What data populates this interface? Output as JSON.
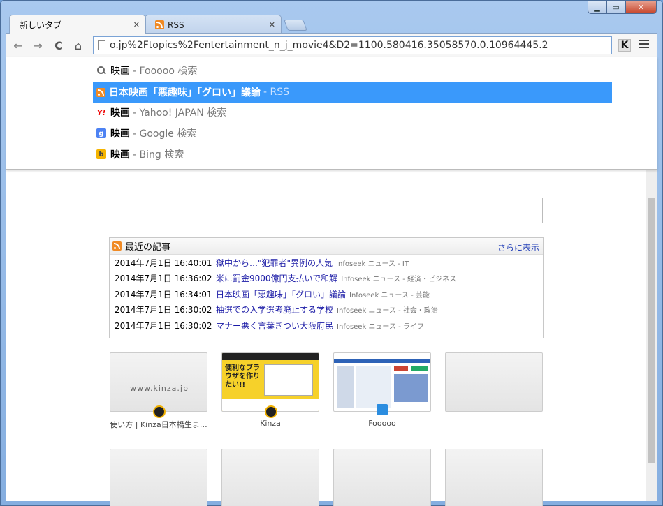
{
  "tabs": [
    {
      "label": "新しいタブ",
      "active": true
    },
    {
      "label": "RSS",
      "active": false
    }
  ],
  "window_controls": {
    "min": "▁",
    "max": "▭",
    "close": "✕"
  },
  "tab_close": "✕",
  "toolbar": {
    "back": "←",
    "forward": "→",
    "reload": "C",
    "home": "⌂",
    "url": "o.jp%2Ftopics%2Fentertainment_n_j_movie4&D2=1100.580416.35058570.0.10964445.2",
    "ext_label": "K"
  },
  "suggestions": [
    {
      "icon": "search-icon",
      "query": "映画",
      "suffix": "- Fooooo 検索",
      "selected": false
    },
    {
      "icon": "rss-icon",
      "query": "日本映画「悪趣味」「グロい」議論",
      "suffix": "- RSS",
      "selected": true
    },
    {
      "icon": "yahoo-icon",
      "query": "映画",
      "suffix": "- Yahoo! JAPAN 検索",
      "selected": false
    },
    {
      "icon": "google-icon",
      "query": "映画",
      "suffix": "- Google 検索",
      "selected": false
    },
    {
      "icon": "bing-icon",
      "query": "映画",
      "suffix": "- Bing 検索",
      "selected": false
    }
  ],
  "icon_glyphs": {
    "yahoo": "Y!",
    "google": "g",
    "bing": "b"
  },
  "feed": {
    "title": "最近の記事",
    "more": "さらに表示",
    "items": [
      {
        "date": "2014年7月1日 16:40:01",
        "title": "獄中から…\"犯罪者\"異例の人気",
        "source": "Infoseek ニュース - IT"
      },
      {
        "date": "2014年7月1日 16:36:02",
        "title": "米に罰金9000億円支払いで和解",
        "source": "Infoseek ニュース - 経済・ビジネス"
      },
      {
        "date": "2014年7月1日 16:34:01",
        "title": "日本映画「悪趣味」「グロい」議論",
        "source": "Infoseek ニュース - 芸能"
      },
      {
        "date": "2014年7月1日 16:30:02",
        "title": "抽選での入学選考廃止する学校",
        "source": "Infoseek ニュース - 社会・政治"
      },
      {
        "date": "2014年7月1日 16:30:02",
        "title": "マナー悪く言葉きつい大阪府民",
        "source": "Infoseek ニュース - ライフ"
      }
    ]
  },
  "tiles": [
    {
      "label": "使い方 | Kinza日本橋生ま…",
      "thumb_text": "www.kinza.jp"
    },
    {
      "label": "Kinza",
      "thumb_text": "便利なブラウザを作りたい!!"
    },
    {
      "label": "Fooooo",
      "thumb_text": ""
    }
  ]
}
